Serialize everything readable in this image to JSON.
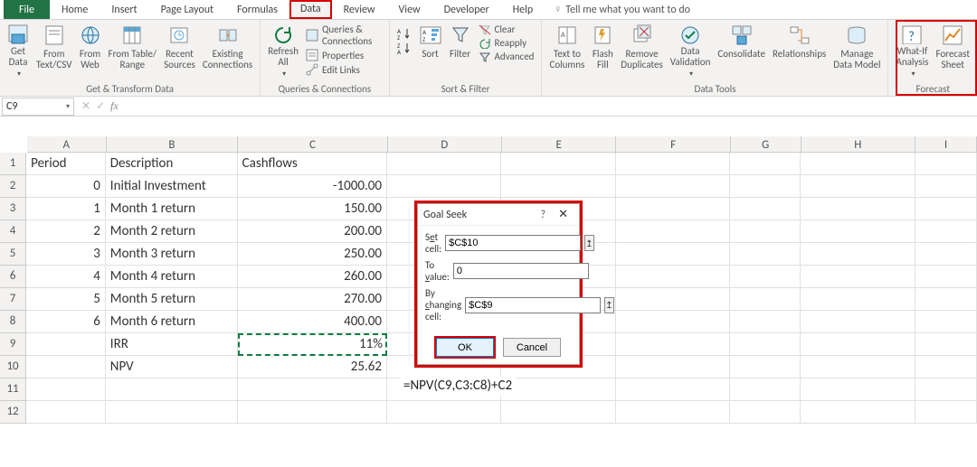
{
  "menu": {
    "tabs": [
      "File",
      "Home",
      "Insert",
      "Page Layout",
      "Formulas",
      "Data",
      "Review",
      "View",
      "Developer",
      "Help"
    ],
    "active_index": 5,
    "tell_me": "Tell me what you want to do"
  },
  "ribbon": {
    "groups": {
      "get_transform": {
        "label": "Get & Transform Data",
        "items": {
          "get_data": "Get\nData",
          "from_text": "From\nText/CSV",
          "from_web": "From\nWeb",
          "from_table": "From Table/\nRange",
          "recent": "Recent\nSources",
          "existing": "Existing\nConnections"
        }
      },
      "queries": {
        "label": "Queries & Connections",
        "refresh": "Refresh\nAll",
        "rows": {
          "qc": "Queries & Connections",
          "props": "Properties",
          "edit": "Edit Links"
        }
      },
      "sort_filter": {
        "label": "Sort & Filter",
        "sort": "Sort",
        "filter": "Filter",
        "rows": {
          "clear": "Clear",
          "reapply": "Reapply",
          "advanced": "Advanced"
        }
      },
      "data_tools": {
        "label": "Data Tools",
        "items": {
          "text_cols": "Text to\nColumns",
          "flash": "Flash\nFill",
          "rem_dup": "Remove\nDuplicates",
          "valid": "Data\nValidation",
          "consol": "Consolidate",
          "rel": "Relationships",
          "mdm": "Manage\nData Model"
        }
      },
      "forecast": {
        "label": "Forecast",
        "items": {
          "whatif": "What-If\nAnalysis",
          "fsheet": "Forecast\nSheet"
        }
      }
    }
  },
  "name_box": "C9",
  "sheet": {
    "col_headers": [
      "A",
      "B",
      "C",
      "D",
      "E",
      "F",
      "G",
      "H",
      "I"
    ],
    "rows": [
      {
        "n": 1,
        "A": "Period",
        "B": "Description",
        "C": "Cashflows"
      },
      {
        "n": 2,
        "A": "0",
        "B": "Initial Investment",
        "C": "-1000.00"
      },
      {
        "n": 3,
        "A": "1",
        "B": "Month 1 return",
        "C": "150.00"
      },
      {
        "n": 4,
        "A": "2",
        "B": "Month 2 return",
        "C": "200.00"
      },
      {
        "n": 5,
        "A": "3",
        "B": "Month 3 return",
        "C": "250.00"
      },
      {
        "n": 6,
        "A": "4",
        "B": "Month 4 return",
        "C": "260.00"
      },
      {
        "n": 7,
        "A": "5",
        "B": "Month 5 return",
        "C": "270.00"
      },
      {
        "n": 8,
        "A": "6",
        "B": "Month 6 return",
        "C": "400.00"
      },
      {
        "n": 9,
        "A": "",
        "B": "IRR",
        "C": "11%"
      },
      {
        "n": 10,
        "A": "",
        "B": "NPV",
        "C": "25.62"
      },
      {
        "n": 11,
        "A": "",
        "B": "",
        "C": ""
      },
      {
        "n": 12,
        "A": "",
        "B": "",
        "C": ""
      }
    ],
    "selected": {
      "row": 9,
      "col": "C"
    },
    "formula_display": {
      "row": 10,
      "col": "D",
      "text": "=NPV(C9,C3:C8)+C2"
    }
  },
  "goal_seek": {
    "title": "Goal Seek",
    "labels": {
      "set_cell": "Set cell:",
      "to_value": "To value:",
      "by_changing": "By changing cell:"
    },
    "values": {
      "set_cell": "$C$10",
      "to_value": "0",
      "by_changing": "$C$9"
    },
    "buttons": {
      "ok": "OK",
      "cancel": "Cancel"
    }
  },
  "chart_data": {
    "type": "table",
    "title": "IRR / NPV cashflow example",
    "columns": [
      "Period",
      "Description",
      "Cashflows"
    ],
    "rows": [
      [
        0,
        "Initial Investment",
        -1000.0
      ],
      [
        1,
        "Month 1 return",
        150.0
      ],
      [
        2,
        "Month 2 return",
        200.0
      ],
      [
        3,
        "Month 3 return",
        250.0
      ],
      [
        4,
        "Month 4 return",
        260.0
      ],
      [
        5,
        "Month 5 return",
        270.0
      ],
      [
        6,
        "Month 6 return",
        400.0
      ]
    ],
    "derived": {
      "IRR": "11%",
      "NPV": 25.62,
      "NPV_formula": "=NPV(C9,C3:C8)+C2"
    }
  }
}
